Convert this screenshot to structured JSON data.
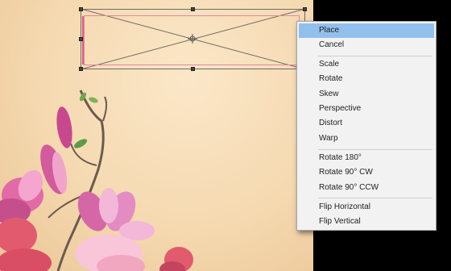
{
  "context_menu": {
    "items": [
      {
        "label": "Place",
        "selected": true
      },
      {
        "label": "Cancel"
      },
      {
        "label": "Scale"
      },
      {
        "label": "Rotate"
      },
      {
        "label": "Skew"
      },
      {
        "label": "Perspective"
      },
      {
        "label": "Distort"
      },
      {
        "label": "Warp"
      },
      {
        "label": "Rotate 180°"
      },
      {
        "label": "Rotate 90° CW"
      },
      {
        "label": "Rotate 90° CCW"
      },
      {
        "label": "Flip Horizontal"
      },
      {
        "label": "Flip Vertical"
      }
    ]
  },
  "colors": {
    "selection_highlight": "#92c0ee",
    "menu_background": "#f2f2f2",
    "canvas_background": "#f5d9b0",
    "placed_frame_pink": "#e087a5"
  }
}
